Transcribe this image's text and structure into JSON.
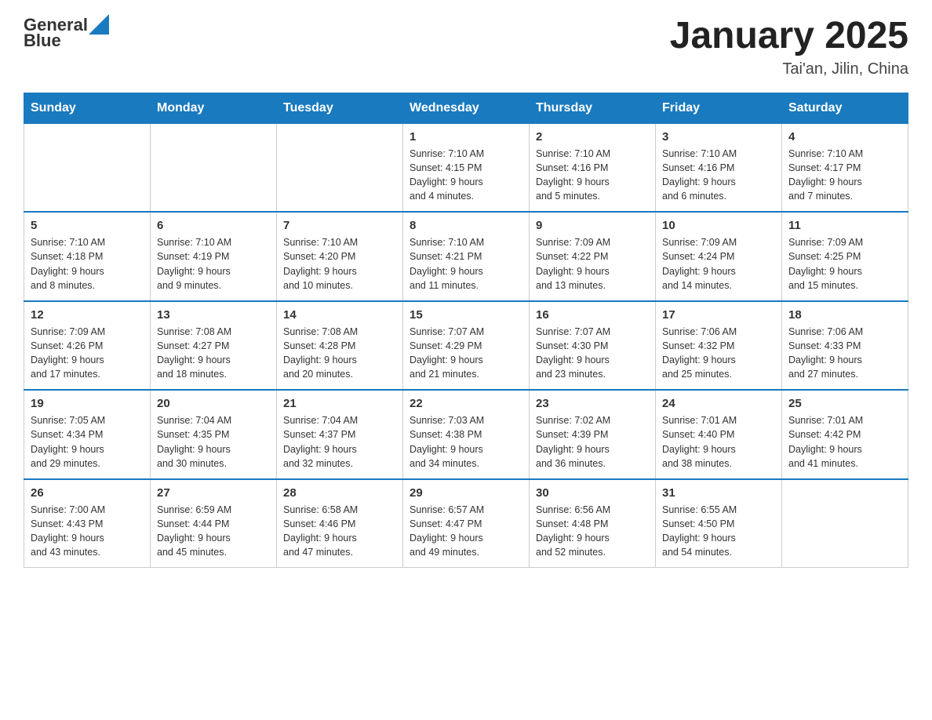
{
  "header": {
    "logo_general": "General",
    "logo_blue": "Blue",
    "title": "January 2025",
    "subtitle": "Tai'an, Jilin, China"
  },
  "weekdays": [
    "Sunday",
    "Monday",
    "Tuesday",
    "Wednesday",
    "Thursday",
    "Friday",
    "Saturday"
  ],
  "weeks": [
    [
      {
        "day": "",
        "info": ""
      },
      {
        "day": "",
        "info": ""
      },
      {
        "day": "",
        "info": ""
      },
      {
        "day": "1",
        "info": "Sunrise: 7:10 AM\nSunset: 4:15 PM\nDaylight: 9 hours\nand 4 minutes."
      },
      {
        "day": "2",
        "info": "Sunrise: 7:10 AM\nSunset: 4:16 PM\nDaylight: 9 hours\nand 5 minutes."
      },
      {
        "day": "3",
        "info": "Sunrise: 7:10 AM\nSunset: 4:16 PM\nDaylight: 9 hours\nand 6 minutes."
      },
      {
        "day": "4",
        "info": "Sunrise: 7:10 AM\nSunset: 4:17 PM\nDaylight: 9 hours\nand 7 minutes."
      }
    ],
    [
      {
        "day": "5",
        "info": "Sunrise: 7:10 AM\nSunset: 4:18 PM\nDaylight: 9 hours\nand 8 minutes."
      },
      {
        "day": "6",
        "info": "Sunrise: 7:10 AM\nSunset: 4:19 PM\nDaylight: 9 hours\nand 9 minutes."
      },
      {
        "day": "7",
        "info": "Sunrise: 7:10 AM\nSunset: 4:20 PM\nDaylight: 9 hours\nand 10 minutes."
      },
      {
        "day": "8",
        "info": "Sunrise: 7:10 AM\nSunset: 4:21 PM\nDaylight: 9 hours\nand 11 minutes."
      },
      {
        "day": "9",
        "info": "Sunrise: 7:09 AM\nSunset: 4:22 PM\nDaylight: 9 hours\nand 13 minutes."
      },
      {
        "day": "10",
        "info": "Sunrise: 7:09 AM\nSunset: 4:24 PM\nDaylight: 9 hours\nand 14 minutes."
      },
      {
        "day": "11",
        "info": "Sunrise: 7:09 AM\nSunset: 4:25 PM\nDaylight: 9 hours\nand 15 minutes."
      }
    ],
    [
      {
        "day": "12",
        "info": "Sunrise: 7:09 AM\nSunset: 4:26 PM\nDaylight: 9 hours\nand 17 minutes."
      },
      {
        "day": "13",
        "info": "Sunrise: 7:08 AM\nSunset: 4:27 PM\nDaylight: 9 hours\nand 18 minutes."
      },
      {
        "day": "14",
        "info": "Sunrise: 7:08 AM\nSunset: 4:28 PM\nDaylight: 9 hours\nand 20 minutes."
      },
      {
        "day": "15",
        "info": "Sunrise: 7:07 AM\nSunset: 4:29 PM\nDaylight: 9 hours\nand 21 minutes."
      },
      {
        "day": "16",
        "info": "Sunrise: 7:07 AM\nSunset: 4:30 PM\nDaylight: 9 hours\nand 23 minutes."
      },
      {
        "day": "17",
        "info": "Sunrise: 7:06 AM\nSunset: 4:32 PM\nDaylight: 9 hours\nand 25 minutes."
      },
      {
        "day": "18",
        "info": "Sunrise: 7:06 AM\nSunset: 4:33 PM\nDaylight: 9 hours\nand 27 minutes."
      }
    ],
    [
      {
        "day": "19",
        "info": "Sunrise: 7:05 AM\nSunset: 4:34 PM\nDaylight: 9 hours\nand 29 minutes."
      },
      {
        "day": "20",
        "info": "Sunrise: 7:04 AM\nSunset: 4:35 PM\nDaylight: 9 hours\nand 30 minutes."
      },
      {
        "day": "21",
        "info": "Sunrise: 7:04 AM\nSunset: 4:37 PM\nDaylight: 9 hours\nand 32 minutes."
      },
      {
        "day": "22",
        "info": "Sunrise: 7:03 AM\nSunset: 4:38 PM\nDaylight: 9 hours\nand 34 minutes."
      },
      {
        "day": "23",
        "info": "Sunrise: 7:02 AM\nSunset: 4:39 PM\nDaylight: 9 hours\nand 36 minutes."
      },
      {
        "day": "24",
        "info": "Sunrise: 7:01 AM\nSunset: 4:40 PM\nDaylight: 9 hours\nand 38 minutes."
      },
      {
        "day": "25",
        "info": "Sunrise: 7:01 AM\nSunset: 4:42 PM\nDaylight: 9 hours\nand 41 minutes."
      }
    ],
    [
      {
        "day": "26",
        "info": "Sunrise: 7:00 AM\nSunset: 4:43 PM\nDaylight: 9 hours\nand 43 minutes."
      },
      {
        "day": "27",
        "info": "Sunrise: 6:59 AM\nSunset: 4:44 PM\nDaylight: 9 hours\nand 45 minutes."
      },
      {
        "day": "28",
        "info": "Sunrise: 6:58 AM\nSunset: 4:46 PM\nDaylight: 9 hours\nand 47 minutes."
      },
      {
        "day": "29",
        "info": "Sunrise: 6:57 AM\nSunset: 4:47 PM\nDaylight: 9 hours\nand 49 minutes."
      },
      {
        "day": "30",
        "info": "Sunrise: 6:56 AM\nSunset: 4:48 PM\nDaylight: 9 hours\nand 52 minutes."
      },
      {
        "day": "31",
        "info": "Sunrise: 6:55 AM\nSunset: 4:50 PM\nDaylight: 9 hours\nand 54 minutes."
      },
      {
        "day": "",
        "info": ""
      }
    ]
  ]
}
